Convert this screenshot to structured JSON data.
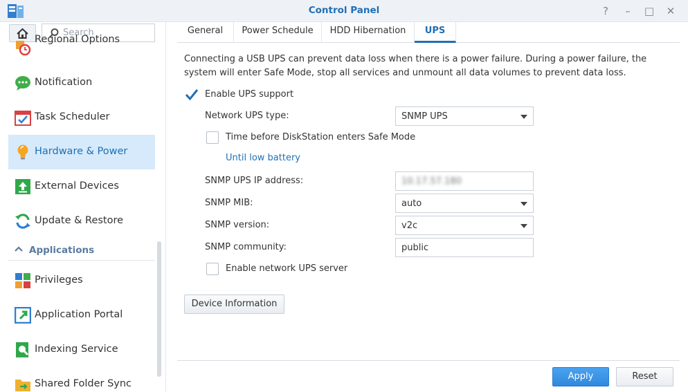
{
  "window": {
    "title": "Control Panel",
    "controls": [
      "?",
      "–",
      "□",
      "✕"
    ]
  },
  "sidebar": {
    "search_placeholder": "Search",
    "items": [
      {
        "label": "Regional Options",
        "icon": "clock-flag-icon"
      },
      {
        "label": "Notification",
        "icon": "chat-bubble-icon"
      },
      {
        "label": "Task Scheduler",
        "icon": "calendar-check-icon"
      },
      {
        "label": "Hardware & Power",
        "icon": "lightbulb-icon",
        "active": true
      },
      {
        "label": "External Devices",
        "icon": "upload-arrow-icon"
      },
      {
        "label": "Update & Restore",
        "icon": "refresh-icon"
      }
    ],
    "section_label": "Applications",
    "app_items": [
      {
        "label": "Privileges",
        "icon": "privileges-icon"
      },
      {
        "label": "Application Portal",
        "icon": "portal-arrow-icon"
      },
      {
        "label": "Indexing Service",
        "icon": "magnifier-doc-icon"
      },
      {
        "label": "Shared Folder Sync",
        "icon": "folder-sync-icon"
      }
    ]
  },
  "tabs": [
    "General",
    "Power Schedule",
    "HDD Hibernation",
    "UPS"
  ],
  "active_tab": "UPS",
  "ups": {
    "description": "Connecting a USB UPS can prevent data loss when there is a power failure. During a power failure, the system will enter Safe Mode, stop all services and unmount all data volumes to prevent data loss.",
    "enable_label": "Enable UPS support",
    "enable_checked": true,
    "network_type_label": "Network UPS type:",
    "network_type_value": "SNMP UPS",
    "time_before_label": "Time before DiskStation enters Safe Mode",
    "time_before_checked": false,
    "until_low_battery": "Until low battery",
    "ip_label": "SNMP UPS IP address:",
    "ip_value": "10.17.57.180",
    "mib_label": "SNMP MIB:",
    "mib_value": "auto",
    "version_label": "SNMP version:",
    "version_value": "v2c",
    "community_label": "SNMP community:",
    "community_value": "public",
    "network_server_label": "Enable network UPS server",
    "network_server_checked": false,
    "device_info_button": "Device Information"
  },
  "footer": {
    "apply": "Apply",
    "reset": "Reset"
  },
  "colors": {
    "accent": "#1f6fb5",
    "active_bg": "#d6eafb",
    "primary_button": "#3a92e2"
  }
}
